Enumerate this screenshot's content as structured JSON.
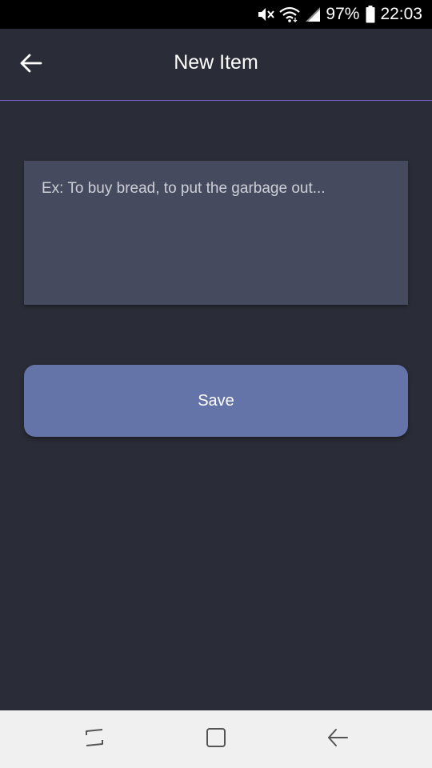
{
  "status_bar": {
    "battery": "97%",
    "time": "22:03",
    "icons": [
      "mute-icon",
      "wifi-icon",
      "signal-icon",
      "battery-icon"
    ]
  },
  "app_bar": {
    "back_icon": "arrow-left-icon",
    "title": "New Item"
  },
  "form": {
    "item_input": {
      "value": "",
      "placeholder": "Ex: To buy bread, to put the garbage out..."
    },
    "save_label": "Save"
  },
  "nav_bar": {
    "buttons": [
      "recents-icon",
      "home-icon",
      "back-icon"
    ]
  },
  "colors": {
    "background": "#2a2c37",
    "divider": "#7b5fc9",
    "input_background": "#464a5e",
    "button_background": "#6473a8",
    "nav_background": "#f0f0f0"
  }
}
